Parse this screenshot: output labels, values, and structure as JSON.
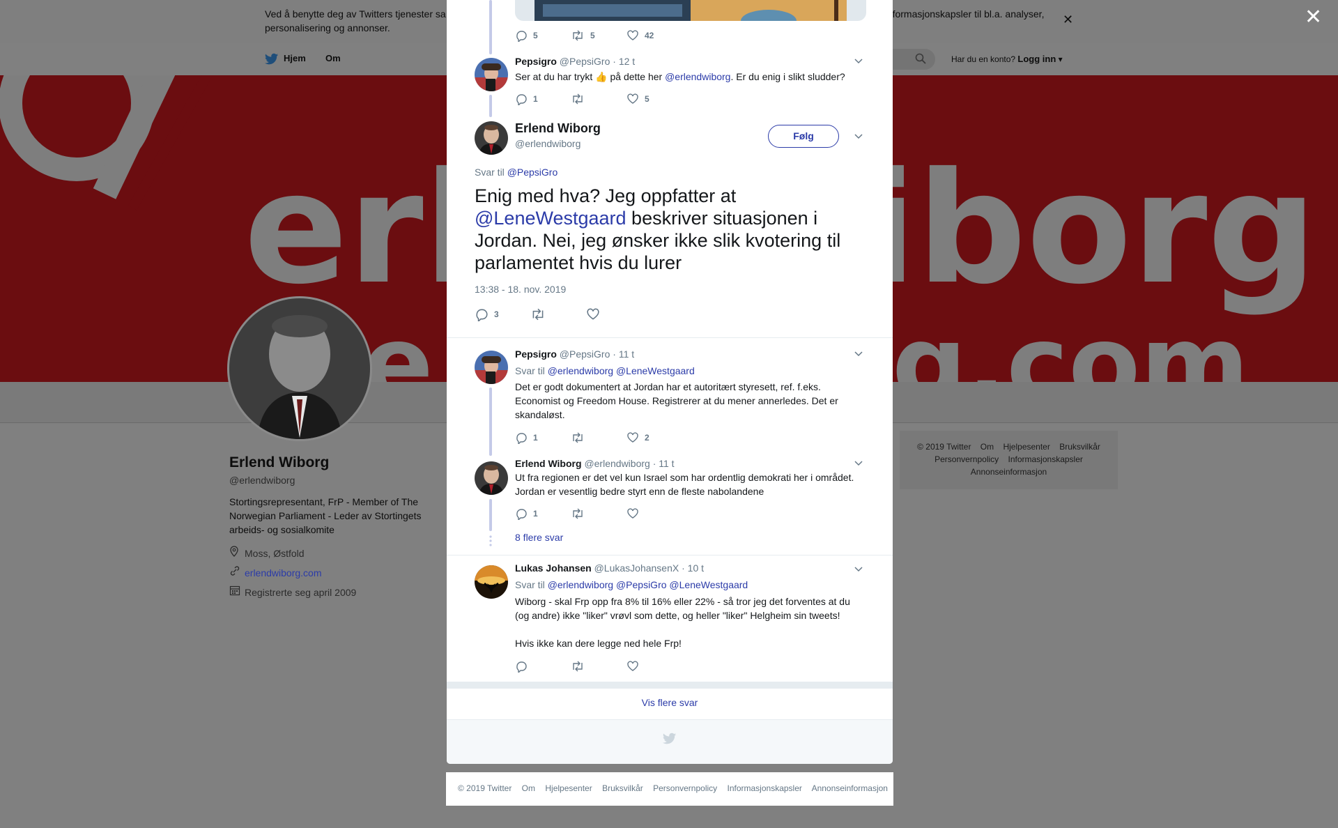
{
  "cookie": {
    "text_left": "Ved å benytte deg av Twitters tjenester sa",
    "text_right": "informasjonskapsler til bl.a. analyser,",
    "text_line2": "personalisering og annonser."
  },
  "nav": {
    "home": "Hjem",
    "about": "Om",
    "login_prompt": "Har du en konto?",
    "login": "Logg inn"
  },
  "banner": {
    "line1_left": "erl",
    "line1_right": "iborg",
    "line2_left": "e",
    "line2_right": "g.com"
  },
  "profile": {
    "name": "Erlend Wiborg",
    "handle": "@erlendwiborg",
    "bio": "Stortingsrepresentant, FrP - Member of The Norwegian Parliament - Leder av Stortingets arbeids- og sosialkomite",
    "location": "Moss, Østfold",
    "website": "erlendwiborg.com",
    "joined": "Registrerte seg april 2009"
  },
  "side_footer": {
    "line1": [
      "© 2019 Twitter",
      "Om",
      "Hjelpesenter",
      "Bruksvilkår"
    ],
    "line2": [
      "Personvernpolicy",
      "Informasjonskapsler"
    ],
    "line3": [
      "Annonseinformasjon"
    ]
  },
  "top_tweet": {
    "replies": "5",
    "retweets": "5",
    "likes": "42"
  },
  "tweet1": {
    "name": "Pepsigro",
    "handle": "@PepsiGro",
    "time": "· 12 t",
    "text_before": "Ser at du har trykt 👍 på dette her ",
    "mention": "@erlendwiborg",
    "text_after": ". Er du enig i slikt sludder?",
    "replies": "1",
    "retweets": "",
    "likes": "5"
  },
  "main_tweet": {
    "name": "Erlend Wiborg",
    "handle": "@erlendwiborg",
    "follow": "Følg",
    "reply_to_label": "Svar til",
    "reply_to": "@PepsiGro",
    "text_before": "Enig med hva? Jeg oppfatter at ",
    "mention": "@LeneWestgaard",
    "text_after": " beskriver situasjonen i Jordan. Nei, jeg ønsker ikke slik kvotering til parlamentet hvis du lurer",
    "timestamp": "13:38 - 18. nov. 2019",
    "replies": "3"
  },
  "reply1": {
    "name": "Pepsigro",
    "handle": "@PepsiGro",
    "time": "· 11 t",
    "reply_to_label": "Svar til",
    "mention1": "@erlendwiborg",
    "mention2": "@LeneWestgaard",
    "text": "Det er godt dokumentert at Jordan har et autoritært styresett, ref. f.eks. Economist og Freedom House. Registrerer at du mener annerledes. Det er skandaløst.",
    "replies": "1",
    "likes": "2"
  },
  "reply2": {
    "name": "Erlend Wiborg",
    "handle": "@erlendwiborg",
    "time": "· 11 t",
    "text": "Ut fra regionen er det vel kun Israel som har ordentlig demokrati her i området. Jordan er vesentlig bedre styrt enn de fleste nabolandene",
    "replies": "1"
  },
  "more_replies": "8 flere svar",
  "reply3": {
    "name": "Lukas Johansen",
    "handle": "@LukasJohansenX",
    "time": "· 10 t",
    "reply_to_label": "Svar til",
    "mention1": "@erlendwiborg",
    "mention2": "@PepsiGro",
    "mention3": "@LeneWestgaard",
    "text1": "Wiborg - skal Frp opp fra 8% til 16% eller 22% - så tror jeg det forventes at du (og andre) ikke \"liker\" vrøvl som dette, og heller \"liker\" Helgheim sin tweets!",
    "text2": "Hvis ikke kan dere legge ned hele Frp!"
  },
  "show_more": "Vis flere svar",
  "footer": [
    "© 2019 Twitter",
    "Om",
    "Hjelpesenter",
    "Bruksvilkår",
    "Personvernpolicy",
    "Informasjonskapsler",
    "Annonseinformasjon"
  ],
  "colors": {
    "link": "#2b3ba8",
    "thread_line": "#c4cae8",
    "gray_text": "#657786",
    "banner_red": "#6b0d10"
  }
}
